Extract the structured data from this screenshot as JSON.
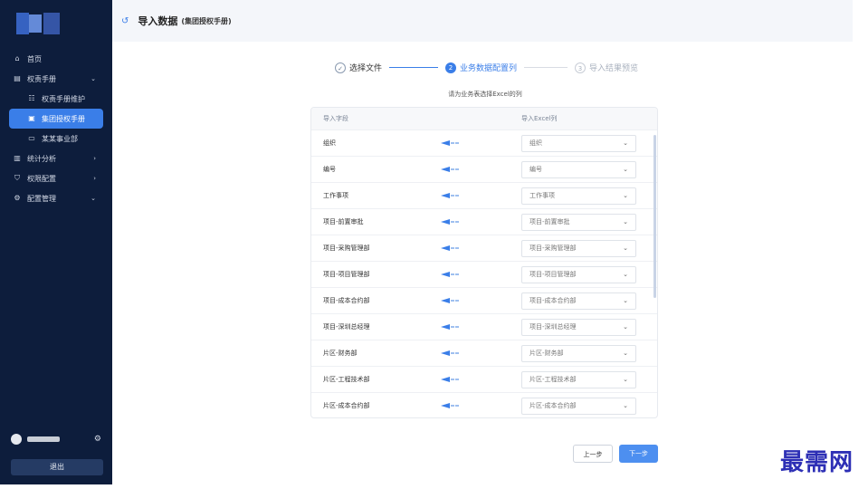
{
  "header": {
    "title": "导入数据",
    "subtitle": "(集团授权手册)"
  },
  "sidebar": {
    "items": [
      {
        "label": "首页",
        "icon": "home-icon"
      },
      {
        "label": "权责手册",
        "icon": "book-icon"
      },
      {
        "label": "权责手册维护",
        "icon": "list-icon"
      },
      {
        "label": "集团授权手册",
        "icon": "doc-icon"
      },
      {
        "label": "某某事业部",
        "icon": "folder-icon"
      },
      {
        "label": "统计分析",
        "icon": "chart-icon"
      },
      {
        "label": "权限配置",
        "icon": "shield-icon"
      },
      {
        "label": "配置管理",
        "icon": "gear-icon"
      }
    ],
    "logout": "退出"
  },
  "steps": [
    {
      "label": "选择文件",
      "num": "✓"
    },
    {
      "label": "业务数据配置列",
      "num": "2"
    },
    {
      "label": "导入结果预览",
      "num": "3"
    }
  ],
  "hint": "请为业务表选择Excel的列",
  "table": {
    "col_field": "导入字段",
    "col_excel": "导入Excel列",
    "rows": [
      {
        "field": "组织",
        "excel": "组织"
      },
      {
        "field": "编号",
        "excel": "编号"
      },
      {
        "field": "工作事项",
        "excel": "工作事项"
      },
      {
        "field": "项目-前置审批",
        "excel": "项目-前置审批"
      },
      {
        "field": "项目-采购管理部",
        "excel": "项目-采购管理部"
      },
      {
        "field": "项目-项目管理部",
        "excel": "项目-项目管理部"
      },
      {
        "field": "项目-成本合约部",
        "excel": "项目-成本合约部"
      },
      {
        "field": "项目-深圳总经理",
        "excel": "项目-深圳总经理"
      },
      {
        "field": "片区-财务部",
        "excel": "片区-财务部"
      },
      {
        "field": "片区-工程技术部",
        "excel": "片区-工程技术部"
      },
      {
        "field": "片区-成本合约部",
        "excel": "片区-成本合约部"
      }
    ]
  },
  "buttons": {
    "prev": "上一步",
    "next": "下一步"
  },
  "watermark": "最需网",
  "colors": {
    "sidebar_bg": "#0d1d3c",
    "accent": "#3a7ee8",
    "header_bg": "#f4f6fa"
  }
}
